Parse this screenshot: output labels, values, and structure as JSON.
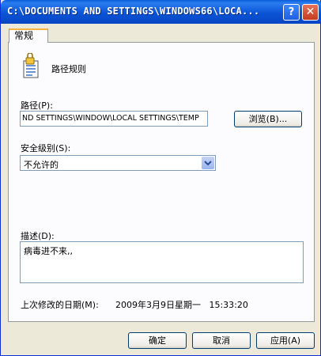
{
  "window": {
    "title": "C:\\DOCUMENTS AND SETTINGS\\WINDOWS66\\LOCA..."
  },
  "controls": {
    "help": "?",
    "close": "✕"
  },
  "tabs": [
    {
      "label": "常规"
    }
  ],
  "rule": {
    "heading": "路径规则"
  },
  "path": {
    "label": "路径(P):",
    "value": "ND SETTINGS\\WINDOW\\LOCAL SETTINGS\\TEMP",
    "browse": "浏览(B)..."
  },
  "security": {
    "label": "安全级别(S):",
    "value": "不允许的"
  },
  "description": {
    "label": "描述(D):",
    "value": "病毒进不来,,"
  },
  "modified": {
    "label": "上次修改的日期(M):",
    "value": "2009年3月9日星期一   15:33:20"
  },
  "footer": {
    "ok": "确定",
    "cancel": "取消",
    "apply": "应用(A)"
  }
}
